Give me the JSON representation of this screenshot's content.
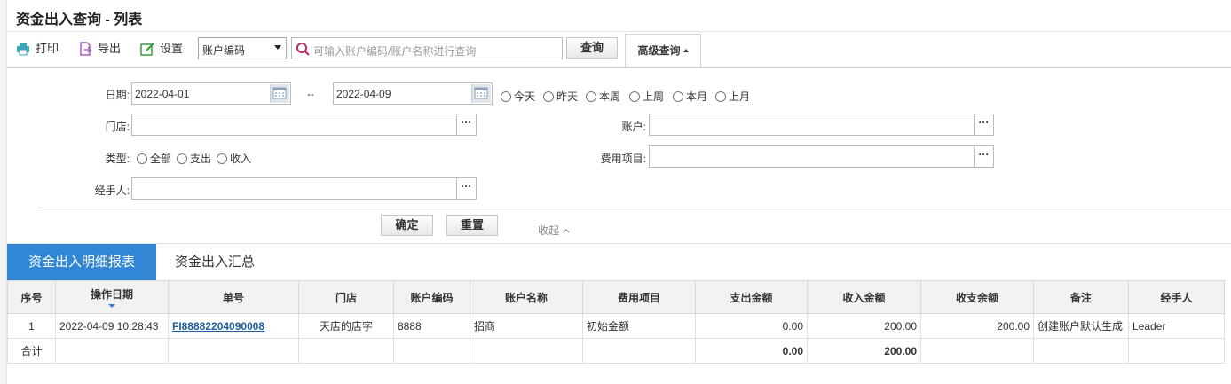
{
  "title": "资金出入查询 - 列表",
  "toolbar": {
    "print": "打印",
    "export": "导出",
    "settings": "设置",
    "field_select": "账户编码",
    "search_placeholder": "可输入账户编码/账户名称进行查询",
    "search_button": "查询",
    "advanced": "高级查询"
  },
  "filters": {
    "date_label": "日期:",
    "date_from": "2022-04-01",
    "date_sep": "--",
    "date_to": "2022-04-09",
    "quick_dates": [
      "今天",
      "昨天",
      "本周",
      "上周",
      "本月",
      "上月"
    ],
    "store_label": "门店:",
    "account_label": "账户:",
    "type_label": "类型:",
    "types": [
      "全部",
      "支出",
      "收入"
    ],
    "expense_label": "费用项目:",
    "handler_label": "经手人:",
    "confirm": "确定",
    "reset": "重置",
    "collapse": "收起"
  },
  "tabs": [
    "资金出入明细报表",
    "资金出入汇总"
  ],
  "table": {
    "columns": [
      "序号",
      "操作日期",
      "单号",
      "门店",
      "账户编码",
      "账户名称",
      "费用项目",
      "支出金额",
      "收入金额",
      "收支余额",
      "备注",
      "经手人"
    ],
    "rows": [
      {
        "index": "1",
        "date": "2022-04-09 10:28:43",
        "number": "FI88882204090008",
        "store": "天店的店字",
        "account_code": "8888",
        "account_name": "招商",
        "expense_item": "初始金额",
        "out_amount": "0.00",
        "in_amount": "200.00",
        "balance": "200.00",
        "remark": "创建账户默认生成",
        "handler": "Leader"
      }
    ],
    "total": {
      "label": "合计",
      "out_amount": "0.00",
      "in_amount": "200.00"
    }
  }
}
